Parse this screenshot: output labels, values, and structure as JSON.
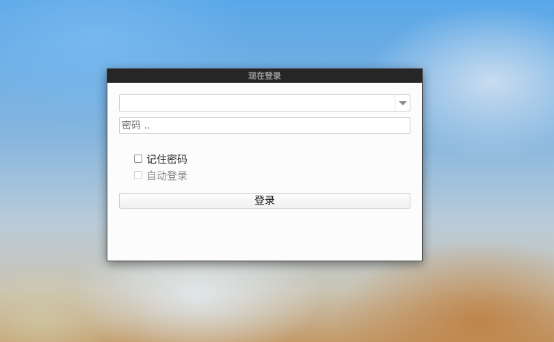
{
  "window": {
    "title": "现在登录"
  },
  "form": {
    "account_value": "",
    "password_placeholder": "密码 ..",
    "remember_label": "记住密码",
    "remember_checked": false,
    "auto_login_label": "自动登录",
    "auto_login_enabled": false,
    "login_label": "登录"
  },
  "icons": {
    "dropdown": "chevron-down-icon"
  }
}
